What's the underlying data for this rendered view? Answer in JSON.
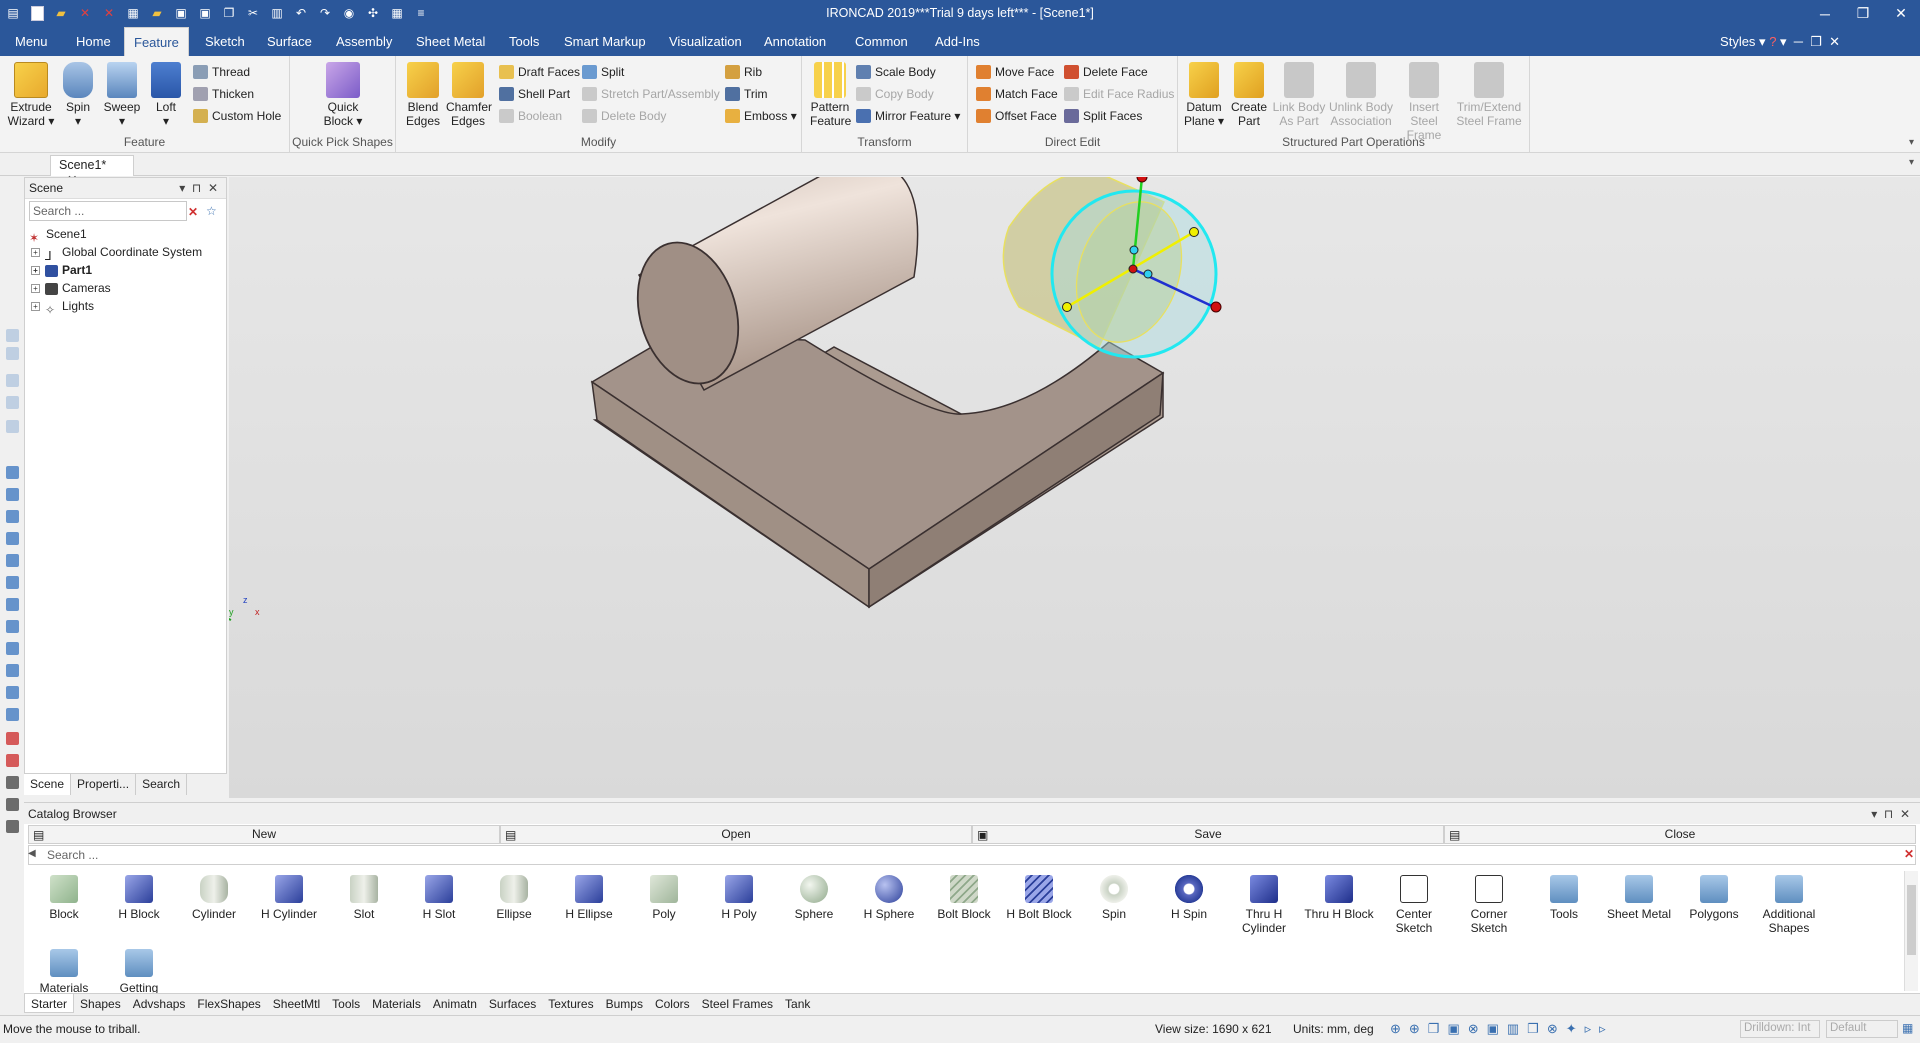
{
  "titlebar": {
    "title": "IRONCAD 2019***Trial 9 days left*** - [Scene1*]"
  },
  "menu_tabs": [
    "Menu",
    "Home",
    "Feature",
    "Sketch",
    "Surface",
    "Assembly",
    "Sheet Metal",
    "Tools",
    "Smart Markup",
    "Visualization",
    "Annotation",
    "Common",
    "Add-Ins"
  ],
  "styles_label": "Styles",
  "ribbon": {
    "feature": {
      "label": "Feature",
      "extrude": "Extrude Wizard",
      "spin": "Spin",
      "sweep": "Sweep",
      "loft": "Loft",
      "thread": "Thread",
      "thicken": "Thicken",
      "custom_hole": "Custom Hole"
    },
    "quick": {
      "label": "Quick Pick Shapes",
      "quick_block": "Quick Block"
    },
    "modify": {
      "label": "Modify",
      "blend": "Blend Edges",
      "chamfer": "Chamfer Edges",
      "draft": "Draft Faces",
      "shell": "Shell Part",
      "boolean": "Boolean",
      "split": "Split",
      "stretch": "Stretch Part/Assembly",
      "delete_body": "Delete Body",
      "rib": "Rib",
      "trim": "Trim",
      "emboss": "Emboss"
    },
    "transform": {
      "label": "Transform",
      "pattern": "Pattern Feature",
      "scale": "Scale Body",
      "copy": "Copy Body",
      "mirror": "Mirror Feature"
    },
    "direct": {
      "label": "Direct Edit",
      "move_face": "Move Face",
      "match_face": "Match Face",
      "offset_face": "Offset Face",
      "delete_face": "Delete Face",
      "edit_radius": "Edit Face Radius",
      "split_faces": "Split Faces"
    },
    "structured": {
      "label": "Structured Part Operations",
      "datum": "Datum Plane",
      "create_part": "Create Part",
      "link_body": "Link Body As Part",
      "unlink_body": "Unlink Body Association",
      "insert_steel": "Insert Steel Frame",
      "trim_steel": "Trim/Extend Steel Frame"
    }
  },
  "doc_tab": "Scene1*",
  "scene_panel": {
    "title": "Scene",
    "search_placeholder": "Search ...",
    "root": "Scene1",
    "items": [
      "Global Coordinate System",
      "Part1",
      "Cameras",
      "Lights"
    ],
    "tabs": [
      "Scene",
      "Properti...",
      "Search"
    ]
  },
  "axis_labels": {
    "z": "z",
    "x": "x",
    "y": "y"
  },
  "catalog": {
    "title": "Catalog Browser",
    "buttons": [
      "New",
      "Open",
      "Save",
      "Close"
    ],
    "search_placeholder": "Search ...",
    "items": [
      "Block",
      "H Block",
      "Cylinder",
      "H Cylinder",
      "Slot",
      "H Slot",
      "Ellipse",
      "H Ellipse",
      "Poly",
      "H Poly",
      "Sphere",
      "H Sphere",
      "Bolt Block",
      "H Bolt Block",
      "Spin",
      "H Spin",
      "Thru H Cylinder",
      "Thru H Block",
      "Center Sketch",
      "Corner Sketch",
      "Tools",
      "Sheet Metal",
      "Polygons",
      "Additional Shapes",
      "Materials",
      "Getting"
    ],
    "tabs": [
      "Starter",
      "Shapes",
      "Advshaps",
      "FlexShapes",
      "SheetMtl",
      "Tools",
      "Materials",
      "Animatn",
      "Surfaces",
      "Textures",
      "Bumps",
      "Colors",
      "Steel Frames",
      "Tank"
    ]
  },
  "status": {
    "message": "Move the mouse to triball.",
    "view_size": "View size: 1690 x  621",
    "units": "Units: mm, deg",
    "drilldown": "Drilldown: Int",
    "default": "Default"
  }
}
